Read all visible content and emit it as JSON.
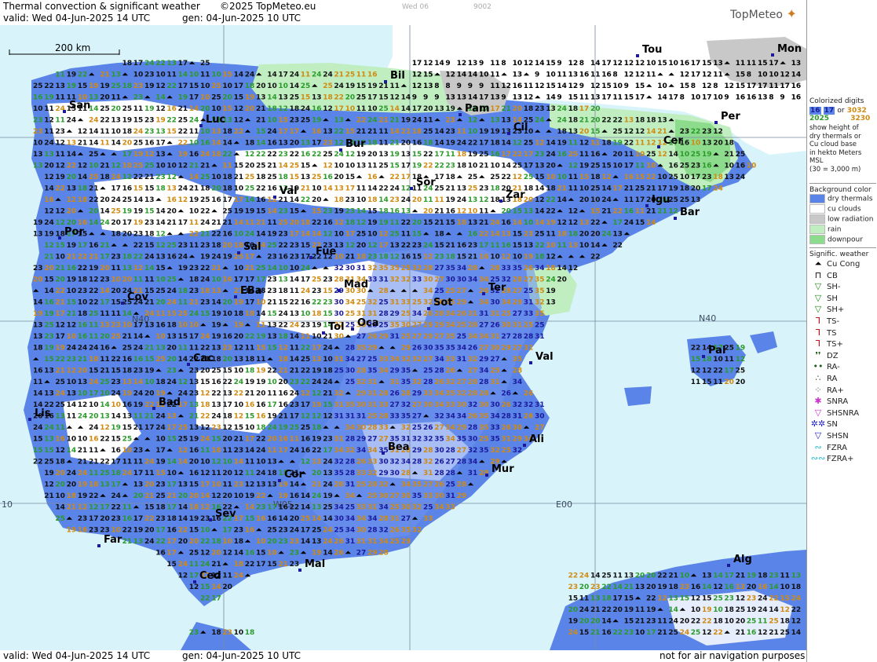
{
  "header": {
    "title": "Thermal convection & significant weather",
    "copyright": "©2025 TopMeteo.eu",
    "day_label": "Wed 06",
    "code": "9002",
    "valid": "valid:  Wed  04-Jun-2025  14 UTC",
    "gen": "gen: 04-Jun-2025 10 UTC",
    "logo": "TopMeteo"
  },
  "footer": {
    "valid": "valid:  Wed  04-Jun-2025  14 UTC",
    "gen": "gen: 04-Jun-2025 10 UTC",
    "note": "not for air navigation purposes"
  },
  "map": {
    "scale_label": "200 km",
    "grid_labels": [
      "N40",
      "N40",
      "E00",
      "W05",
      "10"
    ],
    "cities": [
      "Bil",
      "San",
      "Luc",
      "Pam",
      "Cil",
      "Tou",
      "Mon",
      "Per",
      "Cer",
      "Bur",
      "Sor",
      "Zar",
      "Igu",
      "Bar",
      "Val",
      "Por",
      "Sal",
      "Fue",
      "Mad",
      "Cov",
      "EBa",
      "Sot",
      "Ter",
      "Tol",
      "Oca",
      "Pal",
      "Cac",
      "Val",
      "Bad",
      "Lis",
      "Bea",
      "Ali",
      "Mur",
      "Cor",
      "Sev",
      "Far",
      "Mal",
      "Ced",
      "Alg"
    ],
    "colors": {
      "sea": "#d8f4fa",
      "land": "#ffffff",
      "dry_thermals": "#5b84e8",
      "cu_clouds": "#ffffff",
      "low_radiation": "#c8c8c8",
      "rain": "#c0eec0",
      "downpour": "#8ddc8d",
      "digit_dry": "#1a1a9a",
      "digit_cu_low": "#2a9a2a",
      "digit_cu_high": "#d08a10"
    }
  },
  "legend": {
    "title_lines": [
      "Colorized digits"
    ],
    "sample_digits": [
      "16",
      "17",
      "or",
      "3032",
      "2025",
      "3230"
    ],
    "description_lines": [
      "show height of",
      "dry thermals or",
      "Cu cloud base",
      "in hekto Meters",
      "MSL",
      "(30 = 3,000 m)"
    ],
    "bg_title": "Background color",
    "bg_items": [
      {
        "label": "dry thermals",
        "color": "#5b84e8"
      },
      {
        "label": "cu clouds",
        "color": "#ffffff"
      },
      {
        "label": "low radiation",
        "color": "#c8c8c8"
      },
      {
        "label": "rain",
        "color": "#c0eec0"
      },
      {
        "label": "downpour",
        "color": "#8ddc8d"
      }
    ],
    "wx_title": "Signific. weather",
    "wx_items": [
      {
        "label": "Cu Cong",
        "symbol": "⏶",
        "color": "#000000"
      },
      {
        "label": "CB",
        "symbol": "⊓",
        "color": "#000000"
      },
      {
        "label": "SH-",
        "symbol": "▽",
        "color": "#1f8a1f"
      },
      {
        "label": "SH",
        "symbol": "▽",
        "color": "#1f8a1f"
      },
      {
        "label": "SH+",
        "symbol": "▽",
        "color": "#1f8a1f"
      },
      {
        "label": "TS-",
        "symbol": "Ꞁ",
        "color": "#c00000"
      },
      {
        "label": "TS",
        "symbol": "Ꞁ",
        "color": "#c00000"
      },
      {
        "label": "TS+",
        "symbol": "Ꞁ",
        "color": "#c00000"
      },
      {
        "label": "DZ",
        "symbol": "❜❜",
        "color": "#1f5a1f"
      },
      {
        "label": "RA-",
        "symbol": "••",
        "color": "#1f5a1f"
      },
      {
        "label": "RA",
        "symbol": "∴",
        "color": "#1f5a1f"
      },
      {
        "label": "RA+",
        "symbol": "⁘",
        "color": "#1f5a1f"
      },
      {
        "label": "SNRA",
        "symbol": "✱",
        "color": "#cc33cc"
      },
      {
        "label": "SHSNRA",
        "symbol": "▽",
        "color": "#cc33cc"
      },
      {
        "label": "SN",
        "symbol": "✲✲",
        "color": "#2222cc"
      },
      {
        "label": "SHSN",
        "symbol": "▽",
        "color": "#2222cc"
      },
      {
        "label": "FZRA",
        "symbol": "∾",
        "color": "#22bbcc"
      },
      {
        "label": "FZRA+",
        "symbol": "∾∾",
        "color": "#22bbcc"
      }
    ]
  }
}
